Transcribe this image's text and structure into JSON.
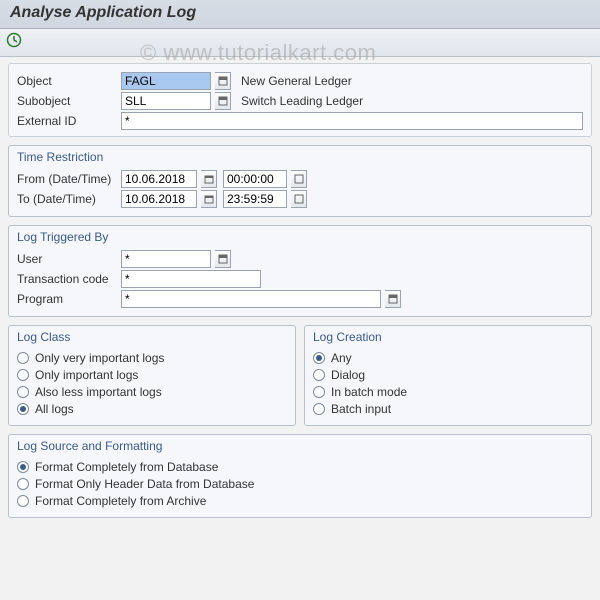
{
  "watermark": "www.tutorialkart.com",
  "title": "Analyse Application Log",
  "header": {
    "object_label": "Object",
    "object_value": "FAGL",
    "object_desc": "New General Ledger",
    "subobject_label": "Subobject",
    "subobject_value": "SLL",
    "subobject_desc": "Switch Leading Ledger",
    "extid_label": "External ID",
    "extid_value": "*"
  },
  "time": {
    "group": "Time Restriction",
    "from_label": "From (Date/Time)",
    "from_date": "10.06.2018",
    "from_time": "00:00:00",
    "to_label": "To (Date/Time)",
    "to_date": "10.06.2018",
    "to_time": "23:59:59"
  },
  "trigger": {
    "group": "Log Triggered By",
    "user_label": "User",
    "user_value": "*",
    "tcode_label": "Transaction code",
    "tcode_value": "*",
    "program_label": "Program",
    "program_value": "*"
  },
  "logclass": {
    "group": "Log Class",
    "opts": [
      "Only very important logs",
      "Only important logs",
      "Also less important logs",
      "All logs"
    ],
    "selected": 3
  },
  "logcreation": {
    "group": "Log Creation",
    "opts": [
      "Any",
      "Dialog",
      "In batch mode",
      "Batch input"
    ],
    "selected": 0
  },
  "source": {
    "group": "Log Source and Formatting",
    "opts": [
      "Format Completely from Database",
      "Format Only Header Data from Database",
      "Format Completely from Archive"
    ],
    "selected": 0
  }
}
